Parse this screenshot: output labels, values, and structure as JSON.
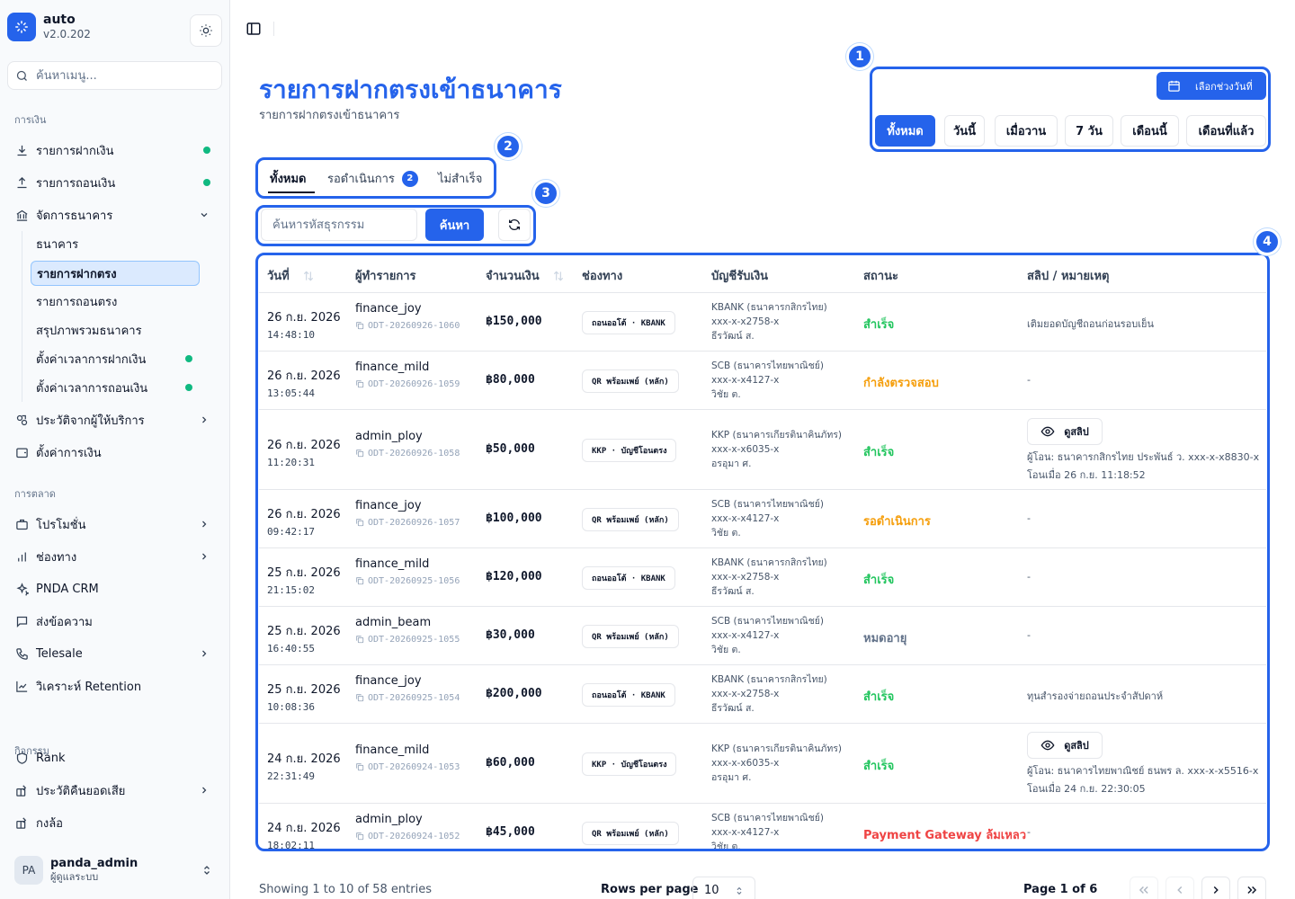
{
  "app": {
    "name": "auto",
    "version": "v2.0.202"
  },
  "sidebar": {
    "search_placeholder": "ค้นหาเมนู...",
    "groups": {
      "finance": "การเงิน",
      "marketing": "การตลาด",
      "activity": "กิจกรรม"
    },
    "items": {
      "deposits": "รายการฝากเงิน",
      "withdrawals": "รายการถอนเงิน",
      "bank_mgmt": "จัดการธนาคาร",
      "provider_history": "ประวัติจากผู้ให้บริการ",
      "finance_settings": "ตั้งค่าการเงิน",
      "promotions": "โปรโมชั่น",
      "channels": "ช่องทาง",
      "crm": "PNDA CRM",
      "messages": "ส่งข้อความ",
      "telesale": "Telesale",
      "retention": "วิเคราะห์ Retention",
      "rank": "Rank",
      "cashback": "ประวัติคืนยอดเสีย",
      "box": "กงล้อ"
    },
    "sub_items": {
      "banks": "ธนาคาร",
      "direct_deposit": "รายการฝากตรง",
      "direct_withdraw": "รายการถอนตรง",
      "bank_summary": "สรุปภาพรวมธนาคาร",
      "deposit_time": "ตั้งค่าเวลาการฝากเงิน",
      "withdraw_time": "ตั้งค่าเวลาการถอนเงิน"
    },
    "user": {
      "initials": "PA",
      "name": "panda_admin",
      "role": "ผู้ดูแลระบบ"
    }
  },
  "page": {
    "title": "รายการฝากตรงเข้าธนาคาร",
    "subtitle": "รายการฝากตรงเข้าธนาคาร"
  },
  "callouts": [
    "1",
    "2",
    "3",
    "4"
  ],
  "date_filter": {
    "picker_label": "เลือกช่วงวันที่",
    "ranges": [
      "ทั้งหมด",
      "วันนี้",
      "เมื่อวาน",
      "7 วัน",
      "เดือนนี้",
      "เดือนที่แล้ว"
    ]
  },
  "tabs": [
    {
      "label": "ทั้งหมด"
    },
    {
      "label": "รอดำเนินการ",
      "badge": "2"
    },
    {
      "label": "ไม่สำเร็จ"
    }
  ],
  "search": {
    "placeholder": "ค้นหารหัสธุรกรรม",
    "button": "ค้นหา"
  },
  "table": {
    "columns": [
      "วันที่",
      "ผู้ทำรายการ",
      "จำนวนเงิน",
      "ช่องทาง",
      "บัญชีรับเงิน",
      "สถานะ",
      "สลิป / หมายเหตุ"
    ],
    "slip_button": "ดูสลิป",
    "rows": [
      {
        "date": "26 ก.ย. 2026",
        "time": "14:48:10",
        "user": "finance_joy",
        "txid": "ODT-20260926-1060",
        "amount": "฿150,000",
        "channel": "ถอนออโต้ · KBANK",
        "bank": "KBANK (ธนาคารกสิกรไทย)",
        "account": "xxx-x-x2758-x",
        "holder": "ธีรวัฒน์ ส.",
        "status": "สำเร็จ",
        "status_color": "#22c55e",
        "note": "เติมยอดบัญชีถอนก่อนรอบเย็น"
      },
      {
        "date": "26 ก.ย. 2026",
        "time": "13:05:44",
        "user": "finance_mild",
        "txid": "ODT-20260926-1059",
        "amount": "฿80,000",
        "channel": "QR พร้อมเพย์ (หลัก)",
        "bank": "SCB (ธนาคารไทยพาณิชย์)",
        "account": "xxx-x-x4127-x",
        "holder": "วิชัย ต.",
        "status": "กำลังตรวจสอบ",
        "status_color": "#f59e0b",
        "note": "-"
      },
      {
        "date": "26 ก.ย. 2026",
        "time": "11:20:31",
        "user": "admin_ploy",
        "txid": "ODT-20260926-1058",
        "amount": "฿50,000",
        "channel": "KKP · บัญชีโอนตรง",
        "bank": "KKP (ธนาคารเกียรตินาคินภัทร)",
        "account": "xxx-x-x6035-x",
        "holder": "อรอุมา ศ.",
        "status": "สำเร็จ",
        "status_color": "#22c55e",
        "note": "",
        "slip_from": "ผู้โอน: ธนาคารกสิกรไทย ประพันธ์ ว. xxx-x-x8830-x",
        "slip_time": "โอนเมื่อ 26 ก.ย. 11:18:52"
      },
      {
        "date": "26 ก.ย. 2026",
        "time": "09:42:17",
        "user": "finance_joy",
        "txid": "ODT-20260926-1057",
        "amount": "฿100,000",
        "channel": "QR พร้อมเพย์ (หลัก)",
        "bank": "SCB (ธนาคารไทยพาณิชย์)",
        "account": "xxx-x-x4127-x",
        "holder": "วิชัย ต.",
        "status": "รอดำเนินการ",
        "status_color": "#f59e0b",
        "note": "-"
      },
      {
        "date": "25 ก.ย. 2026",
        "time": "21:15:02",
        "user": "finance_mild",
        "txid": "ODT-20260925-1056",
        "amount": "฿120,000",
        "channel": "ถอนออโต้ · KBANK",
        "bank": "KBANK (ธนาคารกสิกรไทย)",
        "account": "xxx-x-x2758-x",
        "holder": "ธีรวัฒน์ ส.",
        "status": "สำเร็จ",
        "status_color": "#22c55e",
        "note": "-"
      },
      {
        "date": "25 ก.ย. 2026",
        "time": "16:40:55",
        "user": "admin_beam",
        "txid": "ODT-20260925-1055",
        "amount": "฿30,000",
        "channel": "QR พร้อมเพย์ (หลัก)",
        "bank": "SCB (ธนาคารไทยพาณิชย์)",
        "account": "xxx-x-x4127-x",
        "holder": "วิชัย ต.",
        "status": "หมดอายุ",
        "status_color": "#64748b",
        "note": "-"
      },
      {
        "date": "25 ก.ย. 2026",
        "time": "10:08:36",
        "user": "finance_joy",
        "txid": "ODT-20260925-1054",
        "amount": "฿200,000",
        "channel": "ถอนออโต้ · KBANK",
        "bank": "KBANK (ธนาคารกสิกรไทย)",
        "account": "xxx-x-x2758-x",
        "holder": "ธีรวัฒน์ ส.",
        "status": "สำเร็จ",
        "status_color": "#22c55e",
        "note": "ทุนสำรองจ่ายถอนประจำสัปดาห์"
      },
      {
        "date": "24 ก.ย. 2026",
        "time": "22:31:49",
        "user": "finance_mild",
        "txid": "ODT-20260924-1053",
        "amount": "฿60,000",
        "channel": "KKP · บัญชีโอนตรง",
        "bank": "KKP (ธนาคารเกียรตินาคินภัทร)",
        "account": "xxx-x-x6035-x",
        "holder": "อรอุมา ศ.",
        "status": "สำเร็จ",
        "status_color": "#22c55e",
        "note": "",
        "slip_from": "ผู้โอน: ธนาคารไทยพาณิชย์ ธนพร ล. xxx-x-x5516-x",
        "slip_time": "โอนเมื่อ 24 ก.ย. 22:30:05"
      },
      {
        "date": "24 ก.ย. 2026",
        "time": "18:02:11",
        "user": "admin_ploy",
        "txid": "ODT-20260924-1052",
        "amount": "฿45,000",
        "channel": "QR พร้อมเพย์ (หลัก)",
        "bank": "SCB (ธนาคารไทยพาณิชย์)",
        "account": "xxx-x-x4127-x",
        "holder": "วิชัย ต.",
        "status": "Payment Gateway ล้มเหลว",
        "status_color": "#ef4444",
        "note": "-"
      }
    ]
  },
  "footer": {
    "showing": "Showing 1 to 10 of 58 entries",
    "rows_per_page_label": "Rows per page",
    "rows_per_page_value": "10",
    "page_label": "Page 1 of 6"
  },
  "colors": {
    "accent": "#2563eb",
    "success": "#22c55e",
    "warning": "#f59e0b",
    "danger": "#ef4444",
    "muted": "#64748b",
    "online_dot": "#10b981"
  }
}
